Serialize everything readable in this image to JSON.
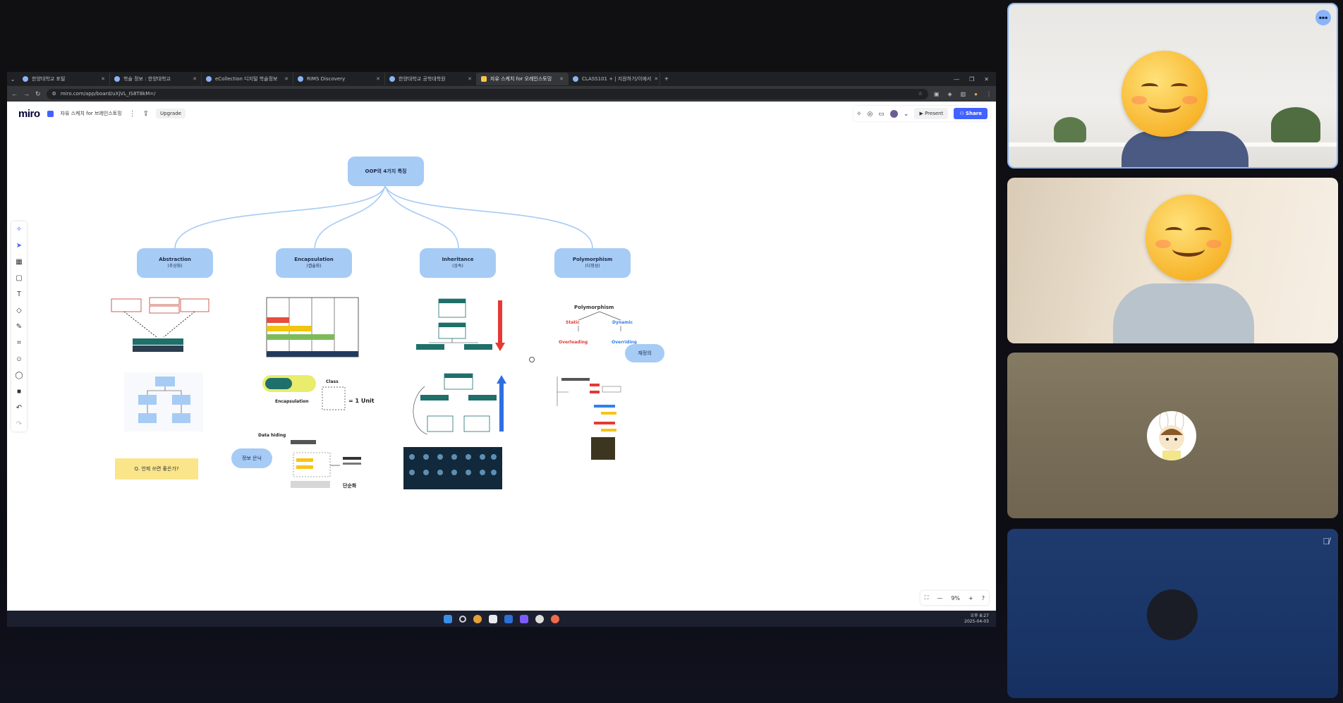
{
  "browser": {
    "tabs": [
      {
        "label": "한양대학교 포털"
      },
      {
        "label": "학술 정보 : 한양대학교"
      },
      {
        "label": "eCollection 디지털 학술정보"
      },
      {
        "label": "RIMS Discovery"
      },
      {
        "label": "한양대학교 공학대학원"
      },
      {
        "label": "자유 스케치 for 오레인스토밍",
        "active": true
      },
      {
        "label": "CLASS101 + | 지원하기/이에서"
      }
    ],
    "url": "miro.com/app/board/uXjVL_IS8T8kM=/"
  },
  "miro": {
    "logo": "miro",
    "board_name": "자유 스케치 for 브레인스토밍",
    "upgrade_label": "Upgrade",
    "present_label": "Present",
    "share_label": "Share",
    "zoom_level": "9%"
  },
  "diagram": {
    "root": "OOP의 4가지 특징",
    "branches": [
      {
        "title": "Abstraction",
        "sub": "(추상화)"
      },
      {
        "title": "Encapsulation",
        "sub": "(캡슐화)"
      },
      {
        "title": "Inheritance",
        "sub": "(상속)"
      },
      {
        "title": "Polymorphism",
        "sub": "(다형성)"
      }
    ],
    "sticky_note": "Q. 언제 쓰면 좋은가?",
    "pill_info_hiding": "정보 은닉",
    "pill_redefine": "재정의",
    "poly_title": "Polymorphism",
    "poly_static": "Static",
    "poly_dynamic": "Dynamic",
    "poly_overloading": "Overloading",
    "poly_overriding": "Overriding",
    "enc_class": "Class",
    "enc_unit": "= 1 Unit",
    "enc_label": "Encapsulation",
    "data_hiding": "Data hiding",
    "simplify": "단순화"
  },
  "taskbar": {
    "time": "오후 8:27",
    "date": "2025-04-03"
  },
  "colors": {
    "node_fill": "#a6cbf5",
    "sticky_fill": "#fbe58b",
    "share_blue": "#4262ff",
    "active_tile_border": "#8ab4f8"
  }
}
